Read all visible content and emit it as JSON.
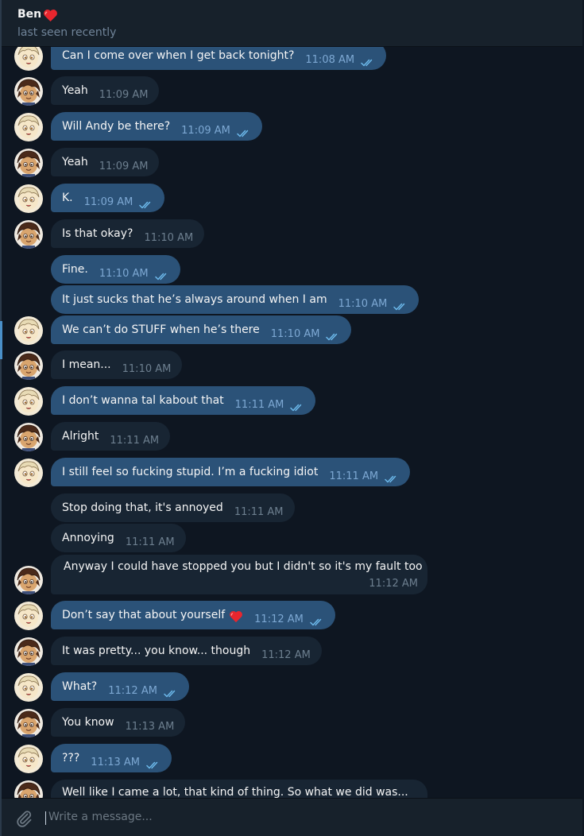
{
  "header": {
    "contact_name": "Ben",
    "status": "last seen recently",
    "name_icon": "heart-icon"
  },
  "colors": {
    "background": "#0e1621",
    "header_bg": "#17212b",
    "outgoing_bubble": "#2b5278",
    "incoming_bubble": "#182533",
    "heart": "#e8262e"
  },
  "messages": [
    {
      "from": "me",
      "text": "Can I come over when I get back tonight?",
      "time": "11:08 AM",
      "read": true
    },
    {
      "from": "ben",
      "text": "Yeah",
      "time": "11:09 AM"
    },
    {
      "from": "me",
      "text": "Will Andy be there?",
      "time": "11:09 AM",
      "read": true
    },
    {
      "from": "ben",
      "text": "Yeah",
      "time": "11:09 AM"
    },
    {
      "from": "me",
      "text": "K.",
      "time": "11:09 AM",
      "read": true
    },
    {
      "from": "ben",
      "text": "Is that okay?",
      "time": "11:10 AM"
    },
    {
      "from": "me",
      "text": "Fine.",
      "time": "11:10 AM",
      "read": true
    },
    {
      "from": "me",
      "text": "It just sucks that he’s always around when I am",
      "time": "11:10 AM",
      "read": true
    },
    {
      "from": "me",
      "text": "We can’t do STUFF when he’s there",
      "time": "11:10 AM",
      "read": true
    },
    {
      "from": "ben",
      "text": "I mean...",
      "time": "11:10 AM"
    },
    {
      "from": "me",
      "text": "I don’t wanna tal kabout that",
      "time": "11:11 AM",
      "read": true
    },
    {
      "from": "ben",
      "text": "Alright",
      "time": "11:11 AM"
    },
    {
      "from": "me",
      "text": "I still feel so fucking stupid. I’m a fucking idiot",
      "time": "11:11 AM",
      "read": true
    },
    {
      "from": "ben",
      "text": "Stop doing that, it's annoyed",
      "time": "11:11 AM"
    },
    {
      "from": "ben",
      "text": "Annoying",
      "time": "11:11 AM"
    },
    {
      "from": "ben",
      "text": "Anyway I could have stopped you but I didn't so it's my fault too",
      "time": "11:12 AM"
    },
    {
      "from": "me",
      "text": "Don’t say that about yourself",
      "time": "11:12 AM",
      "read": true,
      "emoji": "heart-icon"
    },
    {
      "from": "ben",
      "text": "It was pretty... you know... though",
      "time": "11:12 AM"
    },
    {
      "from": "me",
      "text": "What?",
      "time": "11:12 AM",
      "read": true
    },
    {
      "from": "ben",
      "text": "You know",
      "time": "11:13 AM"
    },
    {
      "from": "me",
      "text": "???",
      "time": "11:13 AM",
      "read": true
    },
    {
      "from": "ben",
      "text": "Well like I came a lot, that kind of thing. So what we did was...",
      "time": ""
    }
  ],
  "composer": {
    "placeholder": "Write a message...",
    "attach_icon": "paperclip-icon"
  }
}
